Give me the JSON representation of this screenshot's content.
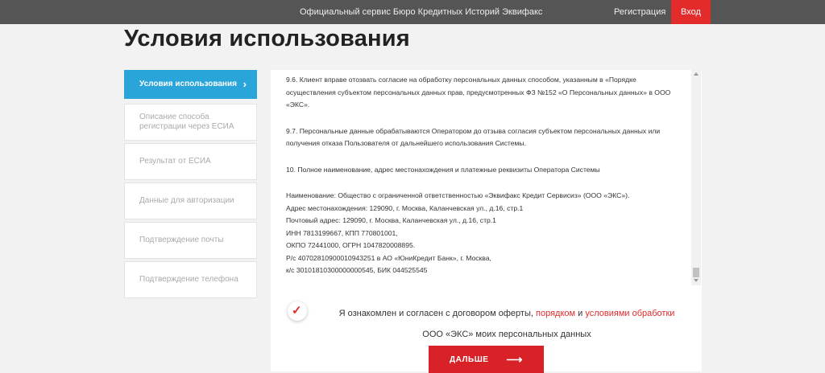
{
  "topbar": {
    "service": "Официальный сервис Бюро Кредитных Историй Эквифакс",
    "register": "Регистрация",
    "login": "Вход"
  },
  "page_title": "Условия использования",
  "sidebar": {
    "items": [
      {
        "label": "Условия использования",
        "active": true,
        "chevron": "›"
      },
      {
        "label": "Описание способа регистрации через ЕСИА"
      },
      {
        "label": "Результат от ЕСИА"
      },
      {
        "label": "Данные для авторизации"
      },
      {
        "label": "Подтверждение почты"
      },
      {
        "label": "Подтверждение телефона"
      }
    ]
  },
  "terms": {
    "p1": "9.6. Клиент вправе отозвать согласие на обработку персональных данных способом, указанным в «Порядке осуществления субъектом персональных данных прав, предусмотренных ФЗ №152 «О Персональных данных» в ООО «ЭКС».",
    "p2": "9.7. Персональные данные обрабатываются Оператором до отзыва согласия субъектом персональных данных или получения отказа Пользователя от дальнейшего использования Системы.",
    "p3": "10. Полное наименование, адрес местонахождения и платежные реквизиты Оператора Системы",
    "details": [
      "Наименование: Общество с ограниченной ответственностью «Эквифакс Кредит Сервисиз» (ООО «ЭКС»).",
      "Адрес местонахождения: 129090, г. Москва, Каланчевская ул., д.16, стр.1",
      "Почтовый адрес: 129090, г. Москва, Каланчевская ул., д.16, стр.1",
      "ИНН 7813199667, КПП 770801001,",
      "ОКПО 72441000, ОГРН 1047820008895.",
      "Р/с 40702810900010943251 в АО «ЮниКредит Банк», г. Москва,",
      "к/с 30101810300000000545, БИК 044525545"
    ]
  },
  "consent": {
    "checked": true,
    "part1": "Я ознакомлен и согласен с договором оферты,",
    "link1": "порядком",
    "and": "и",
    "link2": "условиями обработки",
    "part2": "ООО «ЭКС» моих персональных данных"
  },
  "next_button": {
    "label": "ДАЛЬШЕ",
    "arrow": "⟶"
  },
  "colors": {
    "accent": "#e32b2b",
    "active_tab": "#2aa5d9",
    "topbar": "#555555"
  }
}
